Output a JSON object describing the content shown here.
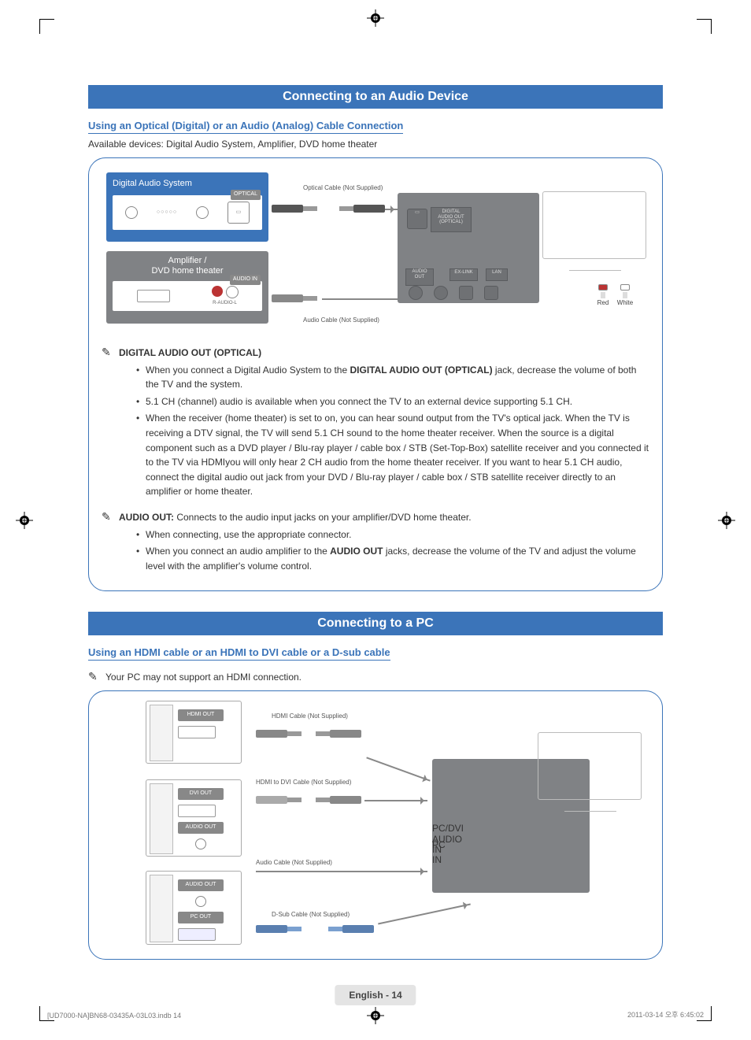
{
  "section1": {
    "header": "Connecting to an Audio Device",
    "subhead": "Using an Optical (Digital) or an Audio (Analog) Cable Connection",
    "lead": "Available devices: Digital Audio System, Amplifier, DVD home theater",
    "diagram": {
      "das_title": "Digital Audio System",
      "optical_label": "OPTICAL",
      "amp_title": "Amplifier /\nDVD home theater",
      "audio_in_label": "AUDIO IN",
      "audio_in_sub": "R-AUDIO-L",
      "optical_cable": "Optical Cable (Not Supplied)",
      "audio_cable": "Audio Cable (Not Supplied)",
      "tv_optical_port": "DIGITAL\nAUDIO OUT\n(OPTICAL)",
      "tv_audio_out": "AUDIO\nOUT",
      "tv_exlink": "EX-LINK",
      "tv_lan": "LAN",
      "plug_red": "Red",
      "plug_white": "White"
    },
    "note1_title": "DIGITAL AUDIO OUT (OPTICAL)",
    "note1_bullets": [
      {
        "pre": "When you connect a Digital Audio System to the ",
        "b": "DIGITAL AUDIO OUT (OPTICAL)",
        "post": " jack, decrease the volume of both the TV and the system."
      },
      {
        "pre": "5.1 CH (channel) audio is available when you connect the TV to an external device supporting 5.1 CH.",
        "b": "",
        "post": ""
      },
      {
        "pre": "When the receiver (home theater) is set to on, you can hear sound output from the TV's optical jack. When the TV is receiving a DTV signal, the TV will send 5.1 CH sound to the home theater receiver. When the source is a digital component such as a DVD player / Blu-ray player / cable box / STB (Set-Top-Box) satellite receiver and you connected it to the TV via HDMIyou will only hear 2 CH audio from the home theater receiver. If you want to hear 5.1 CH audio, connect the digital audio out jack from your DVD / Blu-ray player / cable box / STB satellite receiver directly to an amplifier or home theater.",
        "b": "",
        "post": ""
      }
    ],
    "note2_title": "AUDIO OUT:",
    "note2_lead": " Connects to the audio input jacks on your amplifier/DVD home theater.",
    "note2_bullets": [
      {
        "pre": "When connecting, use the appropriate connector.",
        "b": "",
        "post": ""
      },
      {
        "pre": "When you connect an audio amplifier to the ",
        "b": "AUDIO OUT",
        "post": " jacks, decrease the volume of the TV and adjust the volume level with the amplifier's volume control."
      }
    ]
  },
  "section2": {
    "header": "Connecting to a PC",
    "subhead": "Using an HDMI cable or an HDMI to DVI cable or a D-sub cable",
    "note": "Your PC may not support an HDMI connection.",
    "diagram": {
      "hdmi_out": "HDMI OUT",
      "dvi_out": "DVI OUT",
      "audio_out": "AUDIO OUT",
      "pc_out": "PC OUT",
      "hdmi_cable": "HDMI Cable (Not Supplied)",
      "hdmi_dvi_cable": "HDMI to DVI Cable (Not Supplied)",
      "audio_cable": "Audio Cable (Not Supplied)",
      "dsub_cable": "D-Sub Cable (Not Supplied)",
      "tv_port_pcdvi_audio": "PC/DVI\nAUDIO IN",
      "tv_port_pcin": "PC IN"
    }
  },
  "footer": {
    "page_label": "English - 14",
    "doc_left": "[UD7000-NA]BN68-03435A-03L03.indb   14",
    "doc_right": "2011-03-14   오후 6:45:02"
  }
}
